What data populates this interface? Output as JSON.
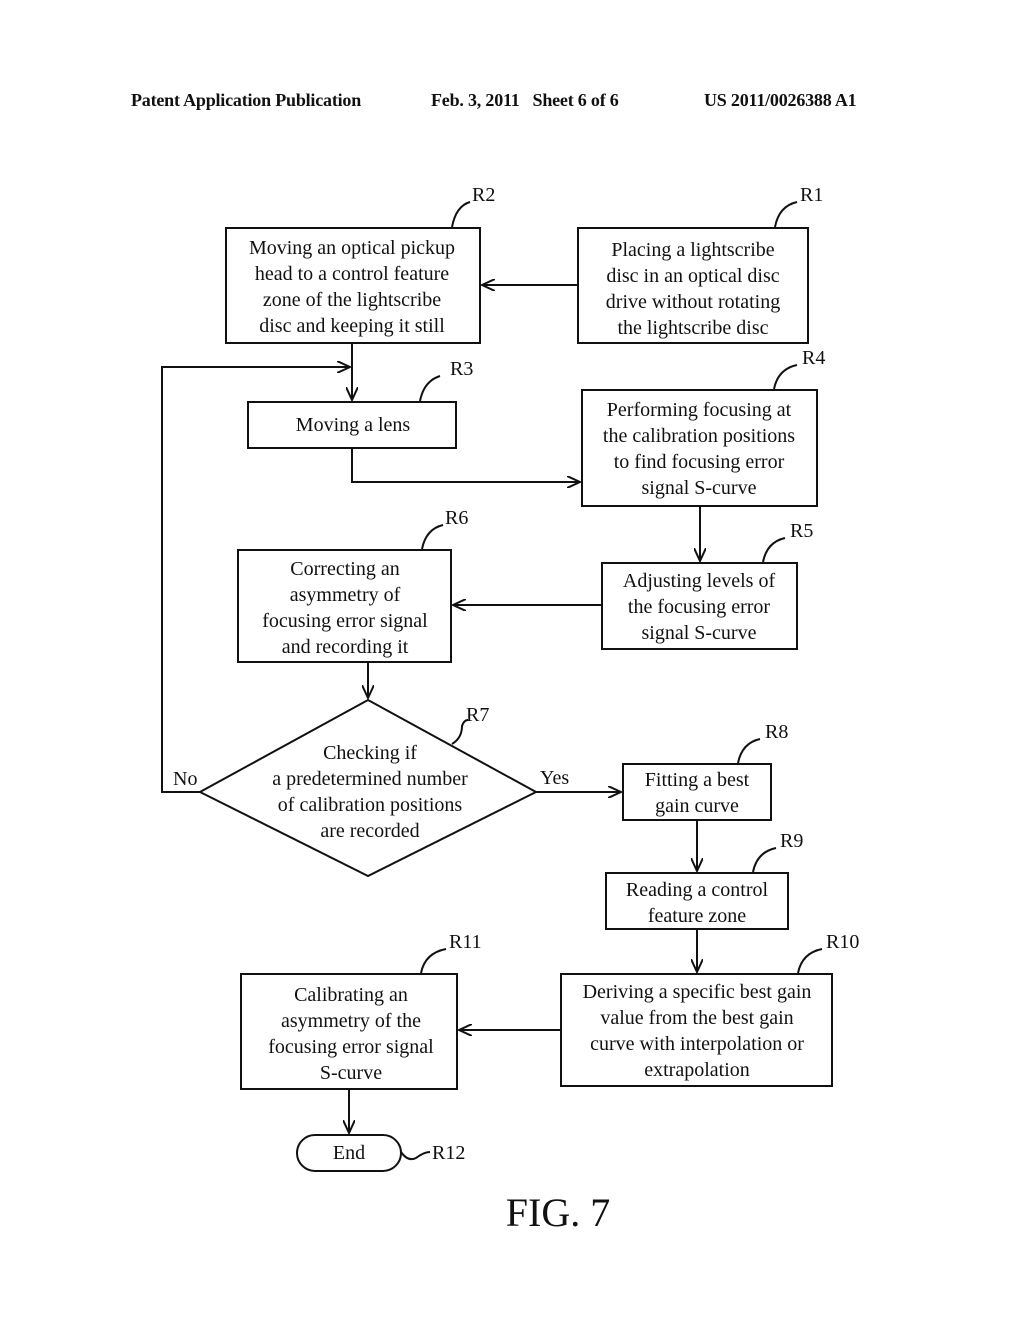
{
  "header": {
    "left": "Patent Application Publication",
    "middle": "Feb. 3, 2011   Sheet 6 of 6",
    "right": "US 2011/0026388 A1"
  },
  "figure_label": "FIG. 7",
  "steps": {
    "R1": {
      "ref": "R1",
      "lines": [
        "Placing a lightscribe",
        "disc in an optical disc",
        "drive without rotating",
        "the lightscribe disc"
      ]
    },
    "R2": {
      "ref": "R2",
      "lines": [
        "Moving an optical pickup",
        "head to a control feature",
        "zone of the lightscribe",
        "disc and keeping it still"
      ]
    },
    "R3": {
      "ref": "R3",
      "lines": [
        "Moving a lens"
      ]
    },
    "R4": {
      "ref": "R4",
      "lines": [
        "Performing focusing at",
        "the calibration positions",
        "to find focusing error",
        "signal S-curve"
      ]
    },
    "R5": {
      "ref": "R5",
      "lines": [
        "Adjusting levels of",
        "the focusing error",
        "signal S-curve"
      ]
    },
    "R6": {
      "ref": "R6",
      "lines": [
        "Correcting an",
        "asymmetry of",
        "focusing error signal",
        "and recording it"
      ]
    },
    "R7": {
      "ref": "R7",
      "lines": [
        "Checking if",
        "a predetermined number",
        "of calibration positions",
        "are recorded"
      ]
    },
    "R8": {
      "ref": "R8",
      "lines": [
        "Fitting a best",
        "gain curve"
      ]
    },
    "R9": {
      "ref": "R9",
      "lines": [
        "Reading a control",
        "feature zone"
      ]
    },
    "R10": {
      "ref": "R10",
      "lines": [
        "Deriving a specific best gain",
        "value from the best gain",
        "curve with interpolation or",
        "extrapolation"
      ]
    },
    "R11": {
      "ref": "R11",
      "lines": [
        "Calibrating an",
        "asymmetry of the",
        "focusing error signal",
        "S-curve"
      ]
    },
    "R12": {
      "ref": "R12",
      "lines": [
        "End"
      ]
    }
  },
  "decision_labels": {
    "no": "No",
    "yes": "Yes"
  }
}
